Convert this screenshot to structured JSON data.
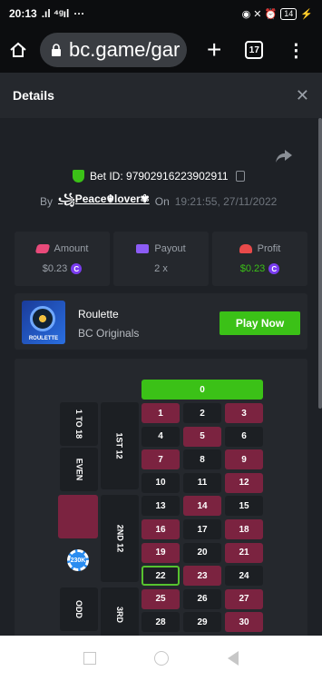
{
  "status": {
    "time": "20:13",
    "signal": ".ıl ⁴ᵍıl",
    "more_dots": "···",
    "icons": "◉ ✕ ⏰",
    "battery": "14"
  },
  "browser": {
    "url": "bc.game/gar",
    "tab_count": "17"
  },
  "details": {
    "title": "Details",
    "bet_id": "Bet ID: 97902916223902911",
    "by_label": "By",
    "username": "꧁Peace☬lover✾",
    "on_label": "On",
    "timestamp": "19:21:55, 27/11/2022"
  },
  "stats": {
    "amount_label": "Amount",
    "amount_value": "$0.23",
    "payout_label": "Payout",
    "payout_value": "2 x",
    "profit_label": "Profit",
    "profit_value": "$0.23"
  },
  "game": {
    "name": "Roulette",
    "provider": "BC Originals",
    "thumb_label": "ROULETTE",
    "play_label": "Play Now"
  },
  "board": {
    "zero": "0",
    "col_low": "1 TO 18",
    "col_even": "EVEN",
    "col_odd": "ODD",
    "dozen1": "1ST 12",
    "dozen2": "2ND 12",
    "dozen3": "3RD",
    "chip_label": "230K",
    "numbers": [
      {
        "n": "1",
        "c": "red"
      },
      {
        "n": "2",
        "c": "black"
      },
      {
        "n": "3",
        "c": "red"
      },
      {
        "n": "4",
        "c": "black"
      },
      {
        "n": "5",
        "c": "red"
      },
      {
        "n": "6",
        "c": "black"
      },
      {
        "n": "7",
        "c": "red"
      },
      {
        "n": "8",
        "c": "black"
      },
      {
        "n": "9",
        "c": "red"
      },
      {
        "n": "10",
        "c": "black"
      },
      {
        "n": "11",
        "c": "black"
      },
      {
        "n": "12",
        "c": "red"
      },
      {
        "n": "13",
        "c": "black"
      },
      {
        "n": "14",
        "c": "red"
      },
      {
        "n": "15",
        "c": "black"
      },
      {
        "n": "16",
        "c": "red"
      },
      {
        "n": "17",
        "c": "black"
      },
      {
        "n": "18",
        "c": "red"
      },
      {
        "n": "19",
        "c": "red"
      },
      {
        "n": "20",
        "c": "black"
      },
      {
        "n": "21",
        "c": "red"
      },
      {
        "n": "22",
        "c": "black"
      },
      {
        "n": "23",
        "c": "red"
      },
      {
        "n": "24",
        "c": "black"
      },
      {
        "n": "25",
        "c": "red"
      },
      {
        "n": "26",
        "c": "black"
      },
      {
        "n": "27",
        "c": "red"
      },
      {
        "n": "28",
        "c": "black"
      },
      {
        "n": "29",
        "c": "black"
      },
      {
        "n": "30",
        "c": "red"
      }
    ],
    "selected": "22"
  },
  "colors": {
    "accent_green": "#3bc117",
    "roulette_red": "#7b2340",
    "coin_purple": "#7a3cf0"
  }
}
